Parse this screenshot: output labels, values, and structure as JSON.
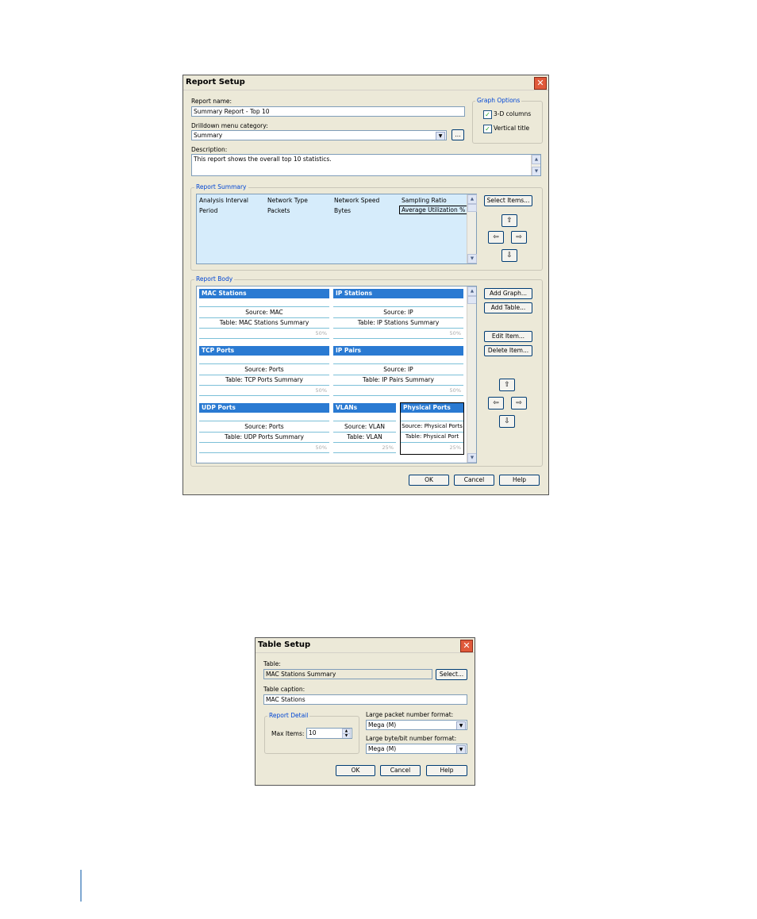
{
  "report_setup": {
    "title": "Report Setup",
    "close": "✕",
    "report_name": {
      "label": "Report name:",
      "value": "Summary Report - Top 10"
    },
    "drilldown": {
      "label": "Drilldown menu category:",
      "value": "Summary",
      "browse": "..."
    },
    "description": {
      "label": "Description:",
      "value": "This report shows the overall top 10 statistics."
    },
    "graph_options": {
      "label": "Graph Options",
      "options": [
        {
          "label": "3-D columns",
          "checked": true
        },
        {
          "label": "Vertical title",
          "checked": true
        }
      ]
    },
    "report_summary": {
      "label": "Report Summary",
      "rows": [
        [
          "Analysis Interval",
          "Network Type",
          "Network Speed",
          "Sampling Ratio"
        ],
        [
          "Period",
          "Packets",
          "Bytes",
          "Average Utilization %"
        ]
      ],
      "select_items": "Select Items..."
    },
    "report_body": {
      "label": "Report Body",
      "tiles": [
        {
          "title": "MAC Stations",
          "source": "Source: MAC",
          "table": "Table: MAC Stations Summary",
          "pct": "50%"
        },
        {
          "title": "IP Stations",
          "source": "Source: IP",
          "table": "Table: IP Stations Summary",
          "pct": "50%"
        },
        {
          "title": "TCP Ports",
          "source": "Source: Ports",
          "table": "Table: TCP Ports Summary",
          "pct": "50%"
        },
        {
          "title": "IP Pairs",
          "source": "Source: IP",
          "table": "Table: IP Pairs Summary",
          "pct": "50%"
        },
        {
          "title": "UDP Ports",
          "source": "Source: Ports",
          "table": "Table: UDP Ports Summary",
          "pct": "50%"
        },
        {
          "title": "VLANs",
          "source": "Source: VLAN",
          "table": "Table: VLAN",
          "pct": "25%"
        },
        {
          "title": "Physical Ports",
          "source": "Source: Physical Ports",
          "table": "Table: Physical Port",
          "pct": "25%"
        }
      ],
      "add_graph": "Add Graph...",
      "add_table": "Add Table...",
      "edit_item": "Edit Item...",
      "delete_item": "Delete Item..."
    },
    "ok": "OK",
    "cancel": "Cancel",
    "help": "Help"
  },
  "table_setup": {
    "title": "Table Setup",
    "close": "✕",
    "table": {
      "label": "Table:",
      "value": "MAC Stations Summary",
      "select": "Select..."
    },
    "caption": {
      "label": "Table caption:",
      "value": "MAC Stations"
    },
    "report_detail": {
      "label": "Report Detail",
      "max_items_label": "Max Items:",
      "max_items": "10"
    },
    "packet_format": {
      "label": "Large packet number format:",
      "value": "Mega (M)"
    },
    "byte_format": {
      "label": "Large byte/bit number format:",
      "value": "Mega (M)"
    },
    "ok": "OK",
    "cancel": "Cancel",
    "help": "Help"
  }
}
